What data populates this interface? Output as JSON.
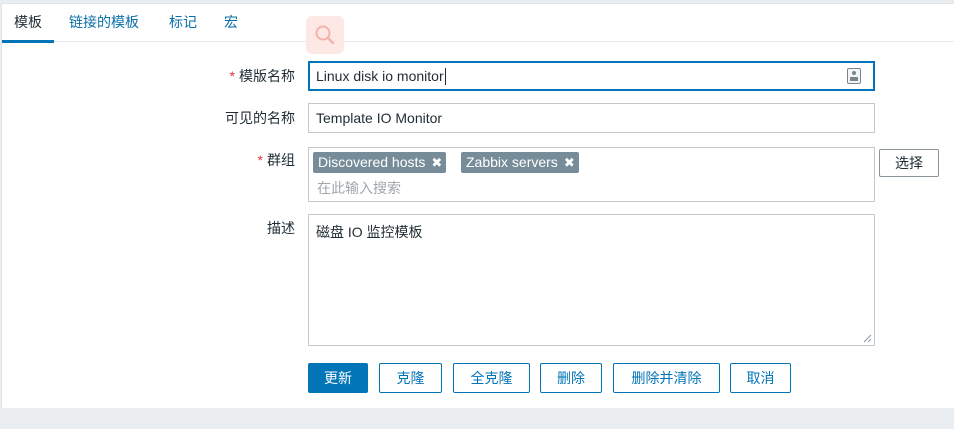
{
  "tabs": [
    {
      "label": "模板"
    },
    {
      "label": "链接的模板"
    },
    {
      "label": "标记"
    },
    {
      "label": "宏"
    }
  ],
  "form": {
    "template_name": {
      "label": "模版名称",
      "value": "Linux disk io monitor",
      "required_mark": "*"
    },
    "visible_name": {
      "label": "可见的名称",
      "value": "Template IO Monitor"
    },
    "groups": {
      "label": "群组",
      "required_mark": "*",
      "chips": [
        "Discovered hosts",
        "Zabbix servers"
      ],
      "placeholder": "在此输入搜索",
      "select_label": "选择"
    },
    "description": {
      "label": "描述",
      "value": "磁盘 IO 监控模板"
    }
  },
  "buttons": {
    "update": "更新",
    "clone": "克隆",
    "full_clone": "全克隆",
    "delete": "删除",
    "delete_and_clear": "删除并清除",
    "cancel": "取消"
  },
  "icons": {
    "chip_remove": "✖"
  },
  "colors": {
    "accent": "#0275b8",
    "chip": "#768d99",
    "required": "#e33734"
  }
}
